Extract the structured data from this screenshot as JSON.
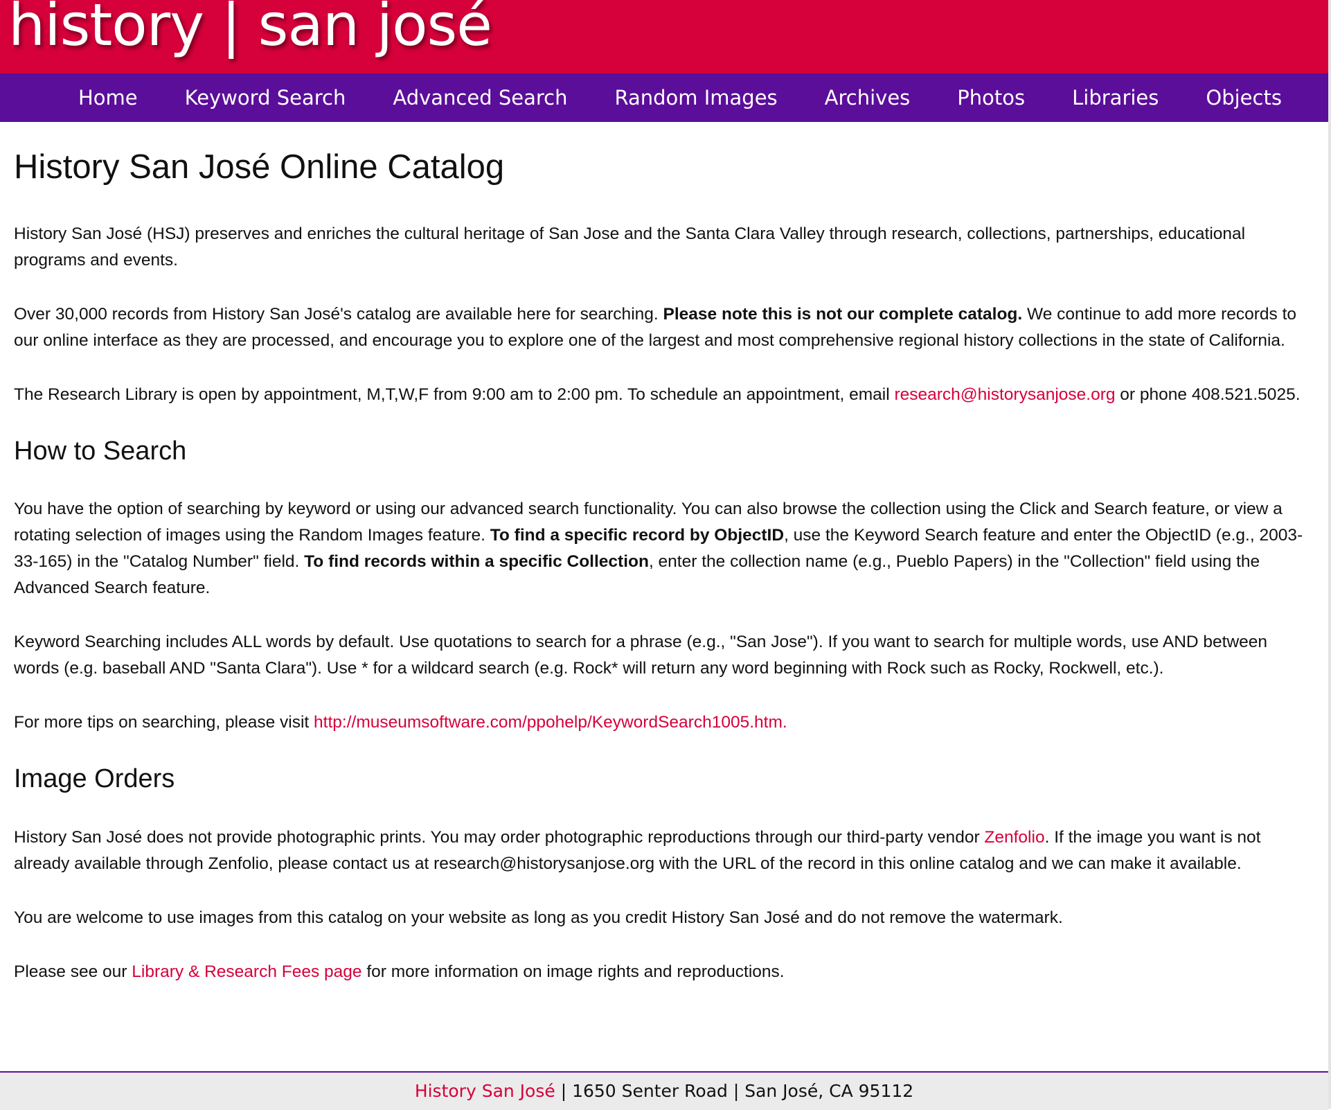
{
  "header": {
    "logo_text": "history | san josé"
  },
  "nav": [
    {
      "label": "Home"
    },
    {
      "label": "Keyword Search"
    },
    {
      "label": "Advanced Search"
    },
    {
      "label": "Random Images"
    },
    {
      "label": "Archives"
    },
    {
      "label": "Photos"
    },
    {
      "label": "Libraries"
    },
    {
      "label": "Objects"
    }
  ],
  "intro": {
    "title": "History San José Online Catalog",
    "p1": "History San José (HSJ) preserves and enriches the cultural heritage of San Jose and the Santa Clara Valley through research, collections, partnerships, educational programs and events.",
    "p2_a": "Over 30,000 records from History San José's catalog are available here for searching. ",
    "p2_bold": "Please note this is not our complete catalog.",
    "p2_b": " We continue to add more records to our online interface as they are processed, and encourage you to explore one of the largest and most comprehensive regional history collections in the state of California.",
    "p3_a": "The Research Library is open by appointment, M,T,W,F from 9:00 am to 2:00 pm. To schedule an appointment, email ",
    "p3_email": "research@historysanjose.org",
    "p3_b": " or phone 408.521.5025."
  },
  "how_to_search": {
    "title": "How to Search",
    "p1_a": "You have the option of searching by keyword or using our advanced search functionality. You can also browse the collection using the Click and Search feature, or view a rotating selection of images using the Random Images feature. ",
    "p1_bold1": "To find a specific record by ObjectID",
    "p1_b": ", use the Keyword Search feature and enter the ObjectID (e.g., 2003-33-165) in the \"Catalog Number\" field. ",
    "p1_bold2": "To find records within a specific Collection",
    "p1_c": ", enter the collection name (e.g., Pueblo Papers) in the \"Collection\" field using the Advanced Search feature.",
    "p2": "Keyword Searching includes ALL words by default. Use quotations to search for a phrase (e.g., \"San Jose\"). If you want to search for multiple words, use AND between words (e.g. baseball AND \"Santa Clara\"). Use * for a wildcard search (e.g. Rock* will return any word beginning with Rock such as Rocky, Rockwell, etc.).",
    "p3_a": "For more tips on searching, please visit ",
    "p3_link": "http://museumsoftware.com/ppohelp/KeywordSearch1005.htm."
  },
  "image_orders": {
    "title": "Image Orders",
    "p1_a": "History San José does not provide photographic prints. You may order photographic reproductions through our third-party vendor ",
    "p1_link": "Zenfolio",
    "p1_b": ". If the image you want is not already available through Zenfolio, please contact us at research@historysanjose.org with the URL of the record in this online catalog and we can make it available.",
    "p2": "You are welcome to use images from this catalog on your website as long as you credit History San José and do not remove the watermark.",
    "p3_a": "Please see our ",
    "p3_link": "Library & Research Fees page",
    "p3_b": " for more information on image rights and reproductions."
  },
  "footer": {
    "org_link": "History San José",
    "rest": " | 1650 Senter Road | San José, CA 95112"
  },
  "colors": {
    "header_red": "#d6003a",
    "nav_purple": "#5b0e9a",
    "link_red": "#d6003a",
    "footer_bg": "#ebebeb"
  }
}
